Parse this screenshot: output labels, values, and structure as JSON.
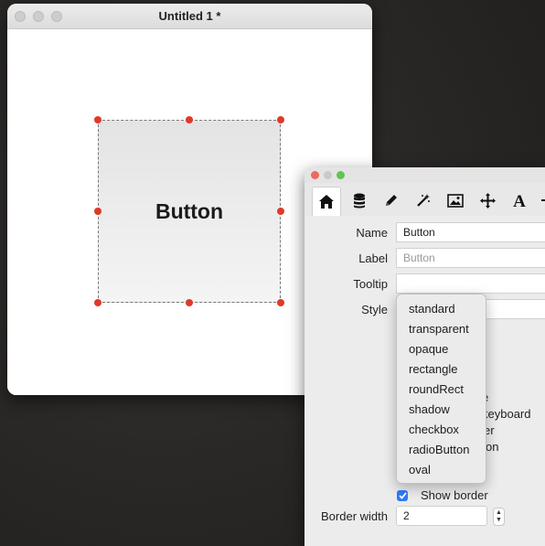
{
  "document_window": {
    "title": "Untitled 1 *",
    "button_label": "Button"
  },
  "inspector": {
    "toolbar_icons": [
      "home-icon",
      "database-icon",
      "pencil-icon",
      "magic-wand-icon",
      "image-icon",
      "move-icon",
      "text-icon",
      "more-icon"
    ],
    "fields": {
      "name_label": "Name",
      "name_value": "Button",
      "label_label": "Label",
      "label_placeholder": "Button",
      "tooltip_label": "Tooltip",
      "tooltip_value": "",
      "style_label": "Style"
    },
    "hidden_options": {
      "partial_1": "e",
      "partial_2": "keyboard",
      "partial_3": "er",
      "partial_4": "on"
    },
    "show_border_label": "Show border",
    "show_border_checked": true,
    "border_width_label": "Border width",
    "border_width_value": "2"
  },
  "style_menu": {
    "options": [
      "standard",
      "transparent",
      "opaque",
      "rectangle",
      "roundRect",
      "shadow",
      "checkbox",
      "radioButton",
      "oval"
    ]
  }
}
